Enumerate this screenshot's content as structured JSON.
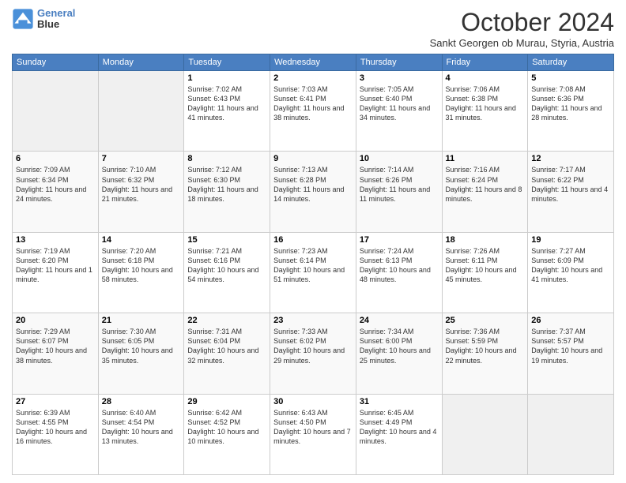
{
  "header": {
    "logo_line1": "General",
    "logo_line2": "Blue",
    "month": "October 2024",
    "location": "Sankt Georgen ob Murau, Styria, Austria"
  },
  "days_of_week": [
    "Sunday",
    "Monday",
    "Tuesday",
    "Wednesday",
    "Thursday",
    "Friday",
    "Saturday"
  ],
  "weeks": [
    [
      {
        "day": "",
        "info": ""
      },
      {
        "day": "",
        "info": ""
      },
      {
        "day": "1",
        "info": "Sunrise: 7:02 AM\nSunset: 6:43 PM\nDaylight: 11 hours and 41 minutes."
      },
      {
        "day": "2",
        "info": "Sunrise: 7:03 AM\nSunset: 6:41 PM\nDaylight: 11 hours and 38 minutes."
      },
      {
        "day": "3",
        "info": "Sunrise: 7:05 AM\nSunset: 6:40 PM\nDaylight: 11 hours and 34 minutes."
      },
      {
        "day": "4",
        "info": "Sunrise: 7:06 AM\nSunset: 6:38 PM\nDaylight: 11 hours and 31 minutes."
      },
      {
        "day": "5",
        "info": "Sunrise: 7:08 AM\nSunset: 6:36 PM\nDaylight: 11 hours and 28 minutes."
      }
    ],
    [
      {
        "day": "6",
        "info": "Sunrise: 7:09 AM\nSunset: 6:34 PM\nDaylight: 11 hours and 24 minutes."
      },
      {
        "day": "7",
        "info": "Sunrise: 7:10 AM\nSunset: 6:32 PM\nDaylight: 11 hours and 21 minutes."
      },
      {
        "day": "8",
        "info": "Sunrise: 7:12 AM\nSunset: 6:30 PM\nDaylight: 11 hours and 18 minutes."
      },
      {
        "day": "9",
        "info": "Sunrise: 7:13 AM\nSunset: 6:28 PM\nDaylight: 11 hours and 14 minutes."
      },
      {
        "day": "10",
        "info": "Sunrise: 7:14 AM\nSunset: 6:26 PM\nDaylight: 11 hours and 11 minutes."
      },
      {
        "day": "11",
        "info": "Sunrise: 7:16 AM\nSunset: 6:24 PM\nDaylight: 11 hours and 8 minutes."
      },
      {
        "day": "12",
        "info": "Sunrise: 7:17 AM\nSunset: 6:22 PM\nDaylight: 11 hours and 4 minutes."
      }
    ],
    [
      {
        "day": "13",
        "info": "Sunrise: 7:19 AM\nSunset: 6:20 PM\nDaylight: 11 hours and 1 minute."
      },
      {
        "day": "14",
        "info": "Sunrise: 7:20 AM\nSunset: 6:18 PM\nDaylight: 10 hours and 58 minutes."
      },
      {
        "day": "15",
        "info": "Sunrise: 7:21 AM\nSunset: 6:16 PM\nDaylight: 10 hours and 54 minutes."
      },
      {
        "day": "16",
        "info": "Sunrise: 7:23 AM\nSunset: 6:14 PM\nDaylight: 10 hours and 51 minutes."
      },
      {
        "day": "17",
        "info": "Sunrise: 7:24 AM\nSunset: 6:13 PM\nDaylight: 10 hours and 48 minutes."
      },
      {
        "day": "18",
        "info": "Sunrise: 7:26 AM\nSunset: 6:11 PM\nDaylight: 10 hours and 45 minutes."
      },
      {
        "day": "19",
        "info": "Sunrise: 7:27 AM\nSunset: 6:09 PM\nDaylight: 10 hours and 41 minutes."
      }
    ],
    [
      {
        "day": "20",
        "info": "Sunrise: 7:29 AM\nSunset: 6:07 PM\nDaylight: 10 hours and 38 minutes."
      },
      {
        "day": "21",
        "info": "Sunrise: 7:30 AM\nSunset: 6:05 PM\nDaylight: 10 hours and 35 minutes."
      },
      {
        "day": "22",
        "info": "Sunrise: 7:31 AM\nSunset: 6:04 PM\nDaylight: 10 hours and 32 minutes."
      },
      {
        "day": "23",
        "info": "Sunrise: 7:33 AM\nSunset: 6:02 PM\nDaylight: 10 hours and 29 minutes."
      },
      {
        "day": "24",
        "info": "Sunrise: 7:34 AM\nSunset: 6:00 PM\nDaylight: 10 hours and 25 minutes."
      },
      {
        "day": "25",
        "info": "Sunrise: 7:36 AM\nSunset: 5:59 PM\nDaylight: 10 hours and 22 minutes."
      },
      {
        "day": "26",
        "info": "Sunrise: 7:37 AM\nSunset: 5:57 PM\nDaylight: 10 hours and 19 minutes."
      }
    ],
    [
      {
        "day": "27",
        "info": "Sunrise: 6:39 AM\nSunset: 4:55 PM\nDaylight: 10 hours and 16 minutes."
      },
      {
        "day": "28",
        "info": "Sunrise: 6:40 AM\nSunset: 4:54 PM\nDaylight: 10 hours and 13 minutes."
      },
      {
        "day": "29",
        "info": "Sunrise: 6:42 AM\nSunset: 4:52 PM\nDaylight: 10 hours and 10 minutes."
      },
      {
        "day": "30",
        "info": "Sunrise: 6:43 AM\nSunset: 4:50 PM\nDaylight: 10 hours and 7 minutes."
      },
      {
        "day": "31",
        "info": "Sunrise: 6:45 AM\nSunset: 4:49 PM\nDaylight: 10 hours and 4 minutes."
      },
      {
        "day": "",
        "info": ""
      },
      {
        "day": "",
        "info": ""
      }
    ]
  ]
}
